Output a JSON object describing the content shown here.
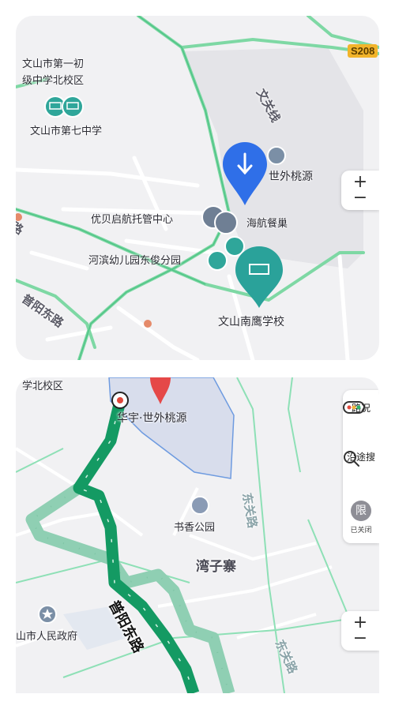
{
  "top_map": {
    "route_badge": "S208",
    "labels": {
      "school_1": "文山市第一初",
      "school_1b": "级中学北校区",
      "school_7": "文山市第七中学",
      "huayu": "世外桃源",
      "youbei": "优贝启航托管中心",
      "haihang": "海航餐巢",
      "hebin": "河滨幼儿园东俊分园",
      "nanying": "文山南鹰学校",
      "road_wenkai": "文关线",
      "road_puyang": "普阳东路",
      "road_left": "普阳东路"
    },
    "zoom": {
      "in": "+",
      "out": "−"
    }
  },
  "bottom_map": {
    "labels": {
      "school_north": "学北校区",
      "huayu_full": "华宇·世外桃源",
      "shuxiang": "书香公园",
      "wanzizhai": "湾子寨",
      "gov": "山市人民政府",
      "road_donghuan": "东关路",
      "road_donghuan2": "东关路",
      "road_puyang": "普阳东路"
    },
    "tools": {
      "traffic": "路况",
      "along": "沿途搜",
      "limit_icon": "限",
      "limit_status": "已关闭"
    },
    "zoom": {
      "in": "+",
      "out": "−"
    },
    "route_color": "#149a63",
    "alt_route_color": "#8fcfb3"
  }
}
